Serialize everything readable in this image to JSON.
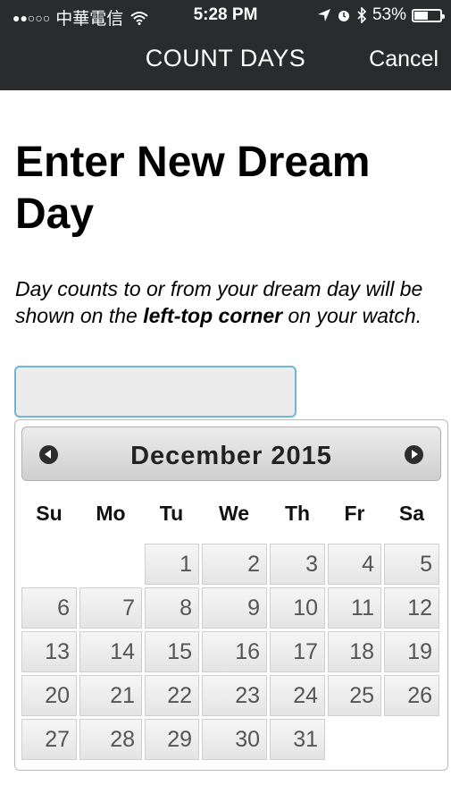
{
  "status_bar": {
    "carrier": "中華電信",
    "time": "5:28 PM",
    "battery": "53%",
    "battery_level": 0.53,
    "icons": [
      "signal-dots-icon",
      "wifi-icon",
      "location-arrow-icon",
      "alarm-icon",
      "bluetooth-icon",
      "battery-icon"
    ]
  },
  "nav": {
    "title": "COUNT DAYS",
    "cancel_label": "Cancel"
  },
  "page": {
    "heading": "Enter New Dream Day",
    "description_prefix": "Day counts to or from your dream day will be shown on the ",
    "description_bold": "left-top corner",
    "description_suffix": " on your watch."
  },
  "date_input": {
    "value": "",
    "placeholder": ""
  },
  "calendar": {
    "month_label": "December 2015",
    "prev_icon": "circle-left-arrow-icon",
    "next_icon": "circle-right-arrow-icon",
    "weekdays": [
      "Su",
      "Mo",
      "Tu",
      "We",
      "Th",
      "Fr",
      "Sa"
    ],
    "first_weekday_index": 2,
    "days": [
      "1",
      "2",
      "3",
      "4",
      "5",
      "6",
      "7",
      "8",
      "9",
      "10",
      "11",
      "12",
      "13",
      "14",
      "15",
      "16",
      "17",
      "18",
      "19",
      "20",
      "21",
      "22",
      "23",
      "24",
      "25",
      "26",
      "27",
      "28",
      "29",
      "30",
      "31"
    ]
  },
  "colors": {
    "header_bar": "#2a2b2d",
    "input_border": "#6fb6d6",
    "input_bg": "#ececec"
  }
}
